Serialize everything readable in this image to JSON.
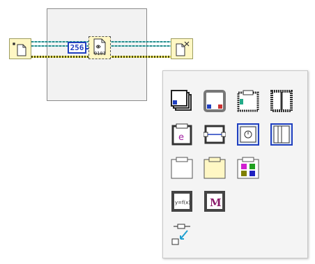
{
  "block_diagram": {
    "numeric_constant": {
      "value": "256"
    },
    "read_binary_node": {
      "label": "0101"
    }
  },
  "structures_palette": {
    "items": [
      {
        "name": "flat-sequence",
        "icon": "flat-sequence-icon"
      },
      {
        "name": "for-loop",
        "icon": "for-loop-icon"
      },
      {
        "name": "case-structure",
        "icon": "case-structure-icon"
      },
      {
        "name": "stacked-sequence",
        "icon": "stacked-sequence-icon"
      },
      {
        "name": "event-structure",
        "icon": "event-structure-icon",
        "label": "e"
      },
      {
        "name": "in-place-element",
        "icon": "in-place-element-icon"
      },
      {
        "name": "timed-structure",
        "icon": "timed-structure-icon"
      },
      {
        "name": "diagram-disable",
        "icon": "diagram-disable-icon"
      },
      {
        "name": "shift-register-structure",
        "icon": "structure-icon"
      },
      {
        "name": "yellow-structure",
        "icon": "yellow-structure-icon"
      },
      {
        "name": "color-box",
        "icon": "color-grid-icon"
      },
      {
        "name": "formula-node",
        "icon": "formula-node-icon",
        "label": "y=f(x)"
      },
      {
        "name": "mathscript-node",
        "icon": "mathscript-node-icon",
        "label": "M"
      },
      {
        "name": "feedback-node",
        "icon": "feedback-node-icon"
      }
    ]
  }
}
